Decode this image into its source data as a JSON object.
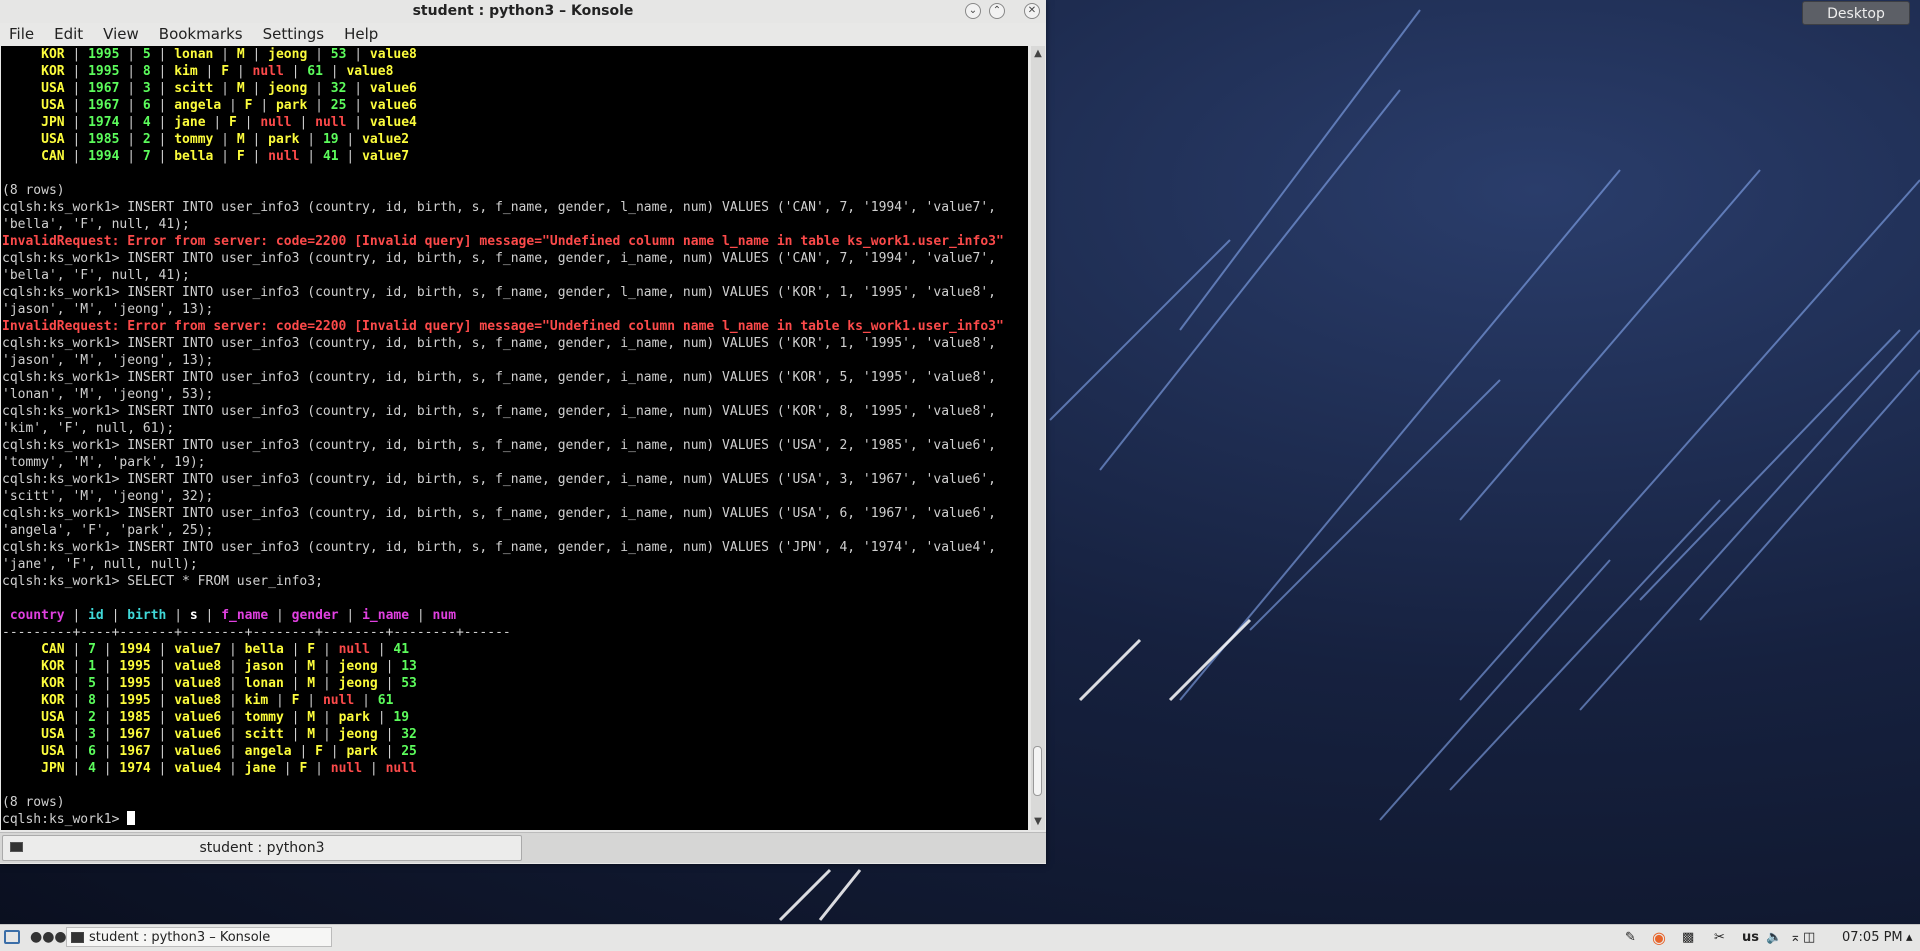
{
  "desktop": {
    "button_label": "Desktop"
  },
  "window": {
    "title": "student : python3 – Konsole",
    "menu": [
      "File",
      "Edit",
      "View",
      "Bookmarks",
      "Settings",
      "Help"
    ],
    "tab_label": "student : python3"
  },
  "terminal": {
    "top_rows": [
      [
        "KOR",
        "1995",
        "5",
        "lonan",
        "M",
        "jeong",
        "53",
        "value8"
      ],
      [
        "KOR",
        "1995",
        "8",
        "kim",
        "F",
        "null",
        "61",
        "value8"
      ],
      [
        "USA",
        "1967",
        "3",
        "scitt",
        "M",
        "jeong",
        "32",
        "value6"
      ],
      [
        "USA",
        "1967",
        "6",
        "angela",
        "F",
        "park",
        "25",
        "value6"
      ],
      [
        "JPN",
        "1974",
        "4",
        "jane",
        "F",
        "null",
        "null",
        "value4"
      ],
      [
        "USA",
        "1985",
        "2",
        "tommy",
        "M",
        "park",
        "19",
        "value2"
      ],
      [
        "CAN",
        "1994",
        "7",
        "bella",
        "F",
        "null",
        "41",
        "value7"
      ]
    ],
    "row_count_1": "(8 rows)",
    "log_lines": [
      {
        "type": "cmd",
        "text": "cqlsh:ks_work1> INSERT INTO user_info3 (country, id, birth, s, f_name, gender, l_name, num) VALUES ('CAN', 7, '1994', 'value7',"
      },
      {
        "type": "cmd",
        "text": "'bella', 'F', null, 41);"
      },
      {
        "type": "err",
        "text": "InvalidRequest: Error from server: code=2200 [Invalid query] message=\"Undefined column name l_name in table ks_work1.user_info3\""
      },
      {
        "type": "cmd",
        "text": "cqlsh:ks_work1> INSERT INTO user_info3 (country, id, birth, s, f_name, gender, i_name, num) VALUES ('CAN', 7, '1994', 'value7',"
      },
      {
        "type": "cmd",
        "text": "'bella', 'F', null, 41);"
      },
      {
        "type": "cmd",
        "text": "cqlsh:ks_work1> INSERT INTO user_info3 (country, id, birth, s, f_name, gender, l_name, num) VALUES ('KOR', 1, '1995', 'value8',"
      },
      {
        "type": "cmd",
        "text": "'jason', 'M', 'jeong', 13);"
      },
      {
        "type": "err",
        "text": "InvalidRequest: Error from server: code=2200 [Invalid query] message=\"Undefined column name l_name in table ks_work1.user_info3\""
      },
      {
        "type": "cmd",
        "text": "cqlsh:ks_work1> INSERT INTO user_info3 (country, id, birth, s, f_name, gender, i_name, num) VALUES ('KOR', 1, '1995', 'value8',"
      },
      {
        "type": "cmd",
        "text": "'jason', 'M', 'jeong', 13);"
      },
      {
        "type": "cmd",
        "text": "cqlsh:ks_work1> INSERT INTO user_info3 (country, id, birth, s, f_name, gender, i_name, num) VALUES ('KOR', 5, '1995', 'value8',"
      },
      {
        "type": "cmd",
        "text": "'lonan', 'M', 'jeong', 53);"
      },
      {
        "type": "cmd",
        "text": "cqlsh:ks_work1> INSERT INTO user_info3 (country, id, birth, s, f_name, gender, i_name, num) VALUES ('KOR', 8, '1995', 'value8',"
      },
      {
        "type": "cmd",
        "text": "'kim', 'F', null, 61);"
      },
      {
        "type": "cmd",
        "text": "cqlsh:ks_work1> INSERT INTO user_info3 (country, id, birth, s, f_name, gender, i_name, num) VALUES ('USA', 2, '1985', 'value6',"
      },
      {
        "type": "cmd",
        "text": "'tommy', 'M', 'park', 19);"
      },
      {
        "type": "cmd",
        "text": "cqlsh:ks_work1> INSERT INTO user_info3 (country, id, birth, s, f_name, gender, i_name, num) VALUES ('USA', 3, '1967', 'value6',"
      },
      {
        "type": "cmd",
        "text": "'scitt', 'M', 'jeong', 32);"
      },
      {
        "type": "cmd",
        "text": "cqlsh:ks_work1> INSERT INTO user_info3 (country, id, birth, s, f_name, gender, i_name, num) VALUES ('USA', 6, '1967', 'value6',"
      },
      {
        "type": "cmd",
        "text": "'angela', 'F', 'park', 25);"
      },
      {
        "type": "cmd",
        "text": "cqlsh:ks_work1> INSERT INTO user_info3 (country, id, birth, s, f_name, gender, i_name, num) VALUES ('JPN', 4, '1974', 'value4',"
      },
      {
        "type": "cmd",
        "text": "'jane', 'F', null, null);"
      },
      {
        "type": "cmd",
        "text": "cqlsh:ks_work1> SELECT * FROM user_info3;"
      }
    ],
    "headers": [
      "country",
      "id",
      "birth",
      "s",
      "f_name",
      "gender",
      "i_name",
      "num"
    ],
    "header_colors": [
      "c-m",
      "c-c",
      "c-c",
      "c-w",
      "c-m",
      "c-m",
      "c-m",
      "c-m"
    ],
    "bottom_rows": [
      [
        "CAN",
        "7",
        "1994",
        "value7",
        "bella",
        "F",
        "null",
        "41"
      ],
      [
        "KOR",
        "1",
        "1995",
        "value8",
        "jason",
        "M",
        "jeong",
        "13"
      ],
      [
        "KOR",
        "5",
        "1995",
        "value8",
        "lonan",
        "M",
        "jeong",
        "53"
      ],
      [
        "KOR",
        "8",
        "1995",
        "value8",
        "kim",
        "F",
        "null",
        "61"
      ],
      [
        "USA",
        "2",
        "1985",
        "value6",
        "tommy",
        "M",
        "park",
        "19"
      ],
      [
        "USA",
        "3",
        "1967",
        "value6",
        "scitt",
        "M",
        "jeong",
        "32"
      ],
      [
        "USA",
        "6",
        "1967",
        "value6",
        "angela",
        "F",
        "park",
        "25"
      ],
      [
        "JPN",
        "4",
        "1974",
        "value4",
        "jane",
        "F",
        "null",
        "null"
      ]
    ],
    "row_count_2": "(8 rows)",
    "prompt": "cqlsh:ks_work1> "
  },
  "taskbar": {
    "task_label": "student : python3 – Konsole",
    "keyboard_layout": "us",
    "clock": "07:05 PM"
  }
}
